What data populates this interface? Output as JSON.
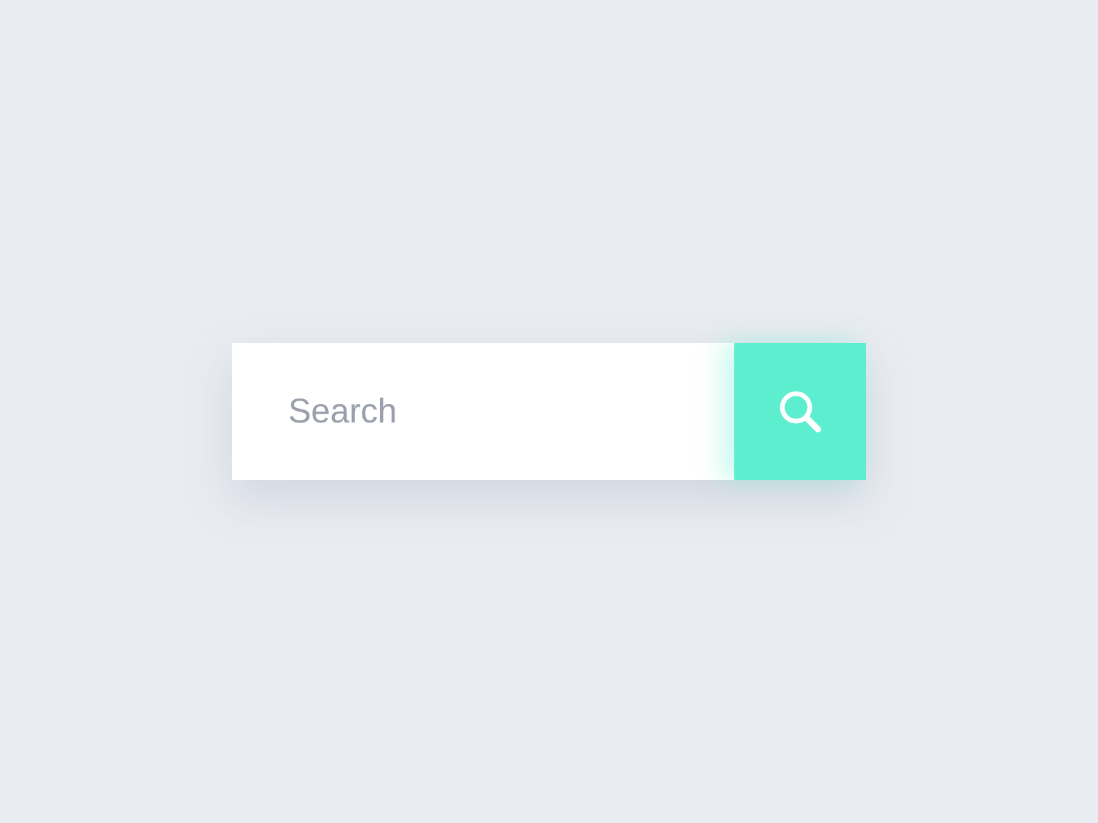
{
  "search": {
    "placeholder": "Search"
  }
}
